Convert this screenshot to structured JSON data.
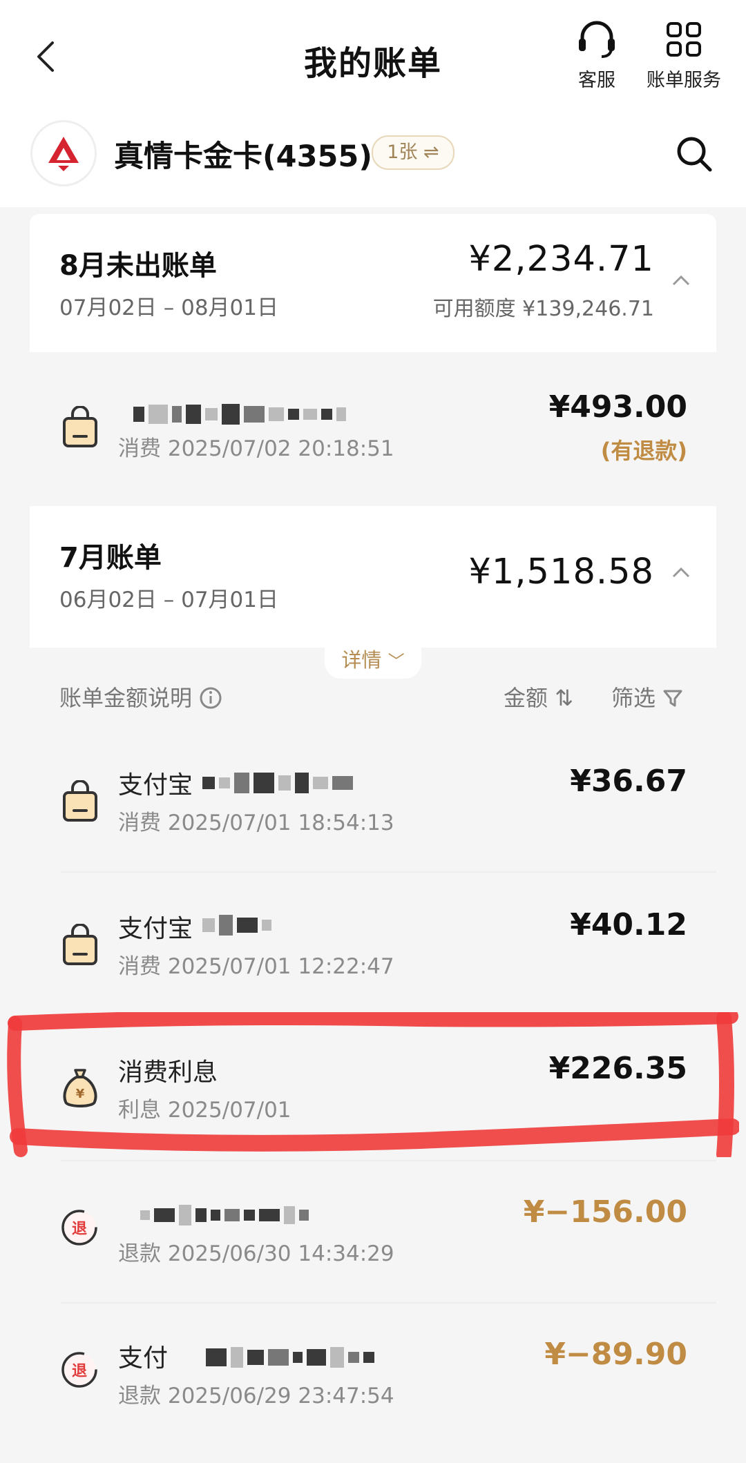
{
  "header": {
    "title": "我的账单",
    "customer_service_label": "客服",
    "bill_service_label": "账单服务"
  },
  "card": {
    "name": "真情卡金卡(4355)",
    "count_chip": "1张 ⇌"
  },
  "august": {
    "title": "8月未出账单",
    "range": "07月02日 – 08月01日",
    "amount": "¥2,234.71",
    "available_credit": "可用额度 ¥139,246.71"
  },
  "august_transactions": [
    {
      "subtitle": "消费 2025/07/02 20:18:51",
      "amount": "¥493.00",
      "note": "(有退款)"
    }
  ],
  "july": {
    "title": "7月账单",
    "range": "06月02日 – 07月01日",
    "amount": "¥1,518.58",
    "detail_label": "详情",
    "explain_label": "账单金额说明",
    "sort_label": "金额",
    "filter_label": "筛选"
  },
  "july_transactions": [
    {
      "title": "支付宝",
      "subtitle": "消费 2025/07/01 18:54:13",
      "amount": "¥36.67"
    },
    {
      "title": "支付宝",
      "subtitle": "消费 2025/07/01 12:22:47",
      "amount": "¥40.12"
    },
    {
      "title": "消费利息",
      "subtitle": "利息 2025/07/01",
      "amount": "¥226.35"
    },
    {
      "title": "",
      "subtitle": "退款 2025/06/30 14:34:29",
      "amount": "¥−156.00",
      "badge": "退"
    },
    {
      "title": "支付",
      "subtitle": "退款 2025/06/29 23:47:54",
      "amount": "¥−89.90",
      "badge": "退"
    }
  ],
  "colors": {
    "accent_gold": "#c08b43",
    "highlight_red": "#ef3b3b",
    "logo_red": "#d5232f"
  },
  "icons": [
    "back-icon",
    "headset-icon",
    "grid-icon",
    "search-icon",
    "shopping-bag-icon",
    "money-bag-icon",
    "refund-icon"
  ]
}
